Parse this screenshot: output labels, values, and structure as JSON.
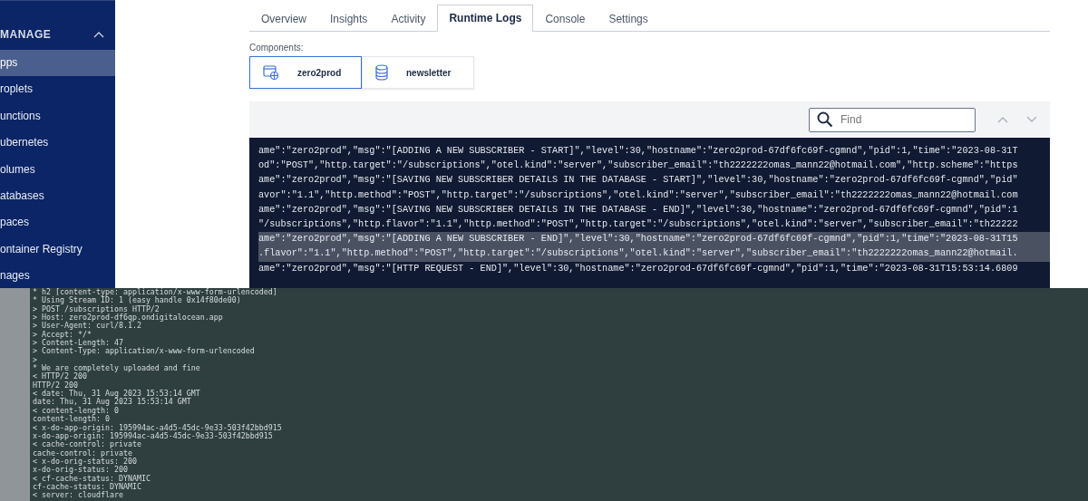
{
  "sidebar": {
    "section": {
      "label": "MANAGE",
      "expanded": true
    },
    "items": [
      {
        "label": "pps",
        "selected": true
      },
      {
        "label": "roplets",
        "selected": false
      },
      {
        "label": "unctions",
        "selected": false
      },
      {
        "label": "ubernetes",
        "selected": false
      },
      {
        "label": "olumes",
        "selected": false
      },
      {
        "label": "atabases",
        "selected": false
      },
      {
        "label": "paces",
        "selected": false
      },
      {
        "label": "ontainer Registry",
        "selected": false
      },
      {
        "label": "nages",
        "selected": false
      }
    ]
  },
  "tabs": [
    {
      "label": "Overview",
      "selected": false
    },
    {
      "label": "Insights",
      "selected": false
    },
    {
      "label": "Activity",
      "selected": false
    },
    {
      "label": "Runtime Logs",
      "selected": true
    },
    {
      "label": "Console",
      "selected": false
    },
    {
      "label": "Settings",
      "selected": false
    }
  ],
  "components": {
    "label": "Components:",
    "items": [
      {
        "name": "zero2prod",
        "kind": "app",
        "selected": true
      },
      {
        "name": "newsletter",
        "kind": "database",
        "selected": false
      }
    ]
  },
  "log_search": {
    "placeholder": "Find"
  },
  "log_lines": [
    {
      "text": "ame\":\"zero2prod\",\"msg\":\"[ADDING A NEW SUBSCRIBER - START]\",\"level\":30,\"hostname\":\"zero2prod-67df6fc69f-cgmnd\",\"pid\":1,\"time\":\"2023-08-31T",
      "selected": false
    },
    {
      "text": "od\":\"POST\",\"http.target\":\"/subscriptions\",\"otel.kind\":\"server\",\"subscriber_email\":\"th2222222omas_mann22@hotmail.com\",\"http.scheme\":\"https",
      "selected": false
    },
    {
      "text": "ame\":\"zero2prod\",\"msg\":\"[SAVING NEW SUBSCRIBER DETAILS IN THE DATABASE - START]\",\"level\":30,\"hostname\":\"zero2prod-67df6fc69f-cgmnd\",\"pid\"",
      "selected": false
    },
    {
      "text": "avor\":\"1.1\",\"http.method\":\"POST\",\"http.target\":\"/subscriptions\",\"otel.kind\":\"server\",\"subscriber_email\":\"th2222222omas_mann22@hotmail.com",
      "selected": false
    },
    {
      "text": "ame\":\"zero2prod\",\"msg\":\"[SAVING NEW SUBSCRIBER DETAILS IN THE DATABASE - END]\",\"level\":30,\"hostname\":\"zero2prod-67df6fc69f-cgmnd\",\"pid\":1",
      "selected": false
    },
    {
      "text": "\"/subscriptions\",\"http.flavor\":\"1.1\",\"http.method\":\"POST\",\"http.target\":\"/subscriptions\",\"otel.kind\":\"server\",\"subscriber_email\":\"th22222",
      "selected": false
    },
    {
      "text": "ame\":\"zero2prod\",\"msg\":\"[ADDING A NEW SUBSCRIBER - END]\",\"level\":30,\"hostname\":\"zero2prod-67df6fc69f-cgmnd\",\"pid\":1,\"time\":\"2023-08-31T15",
      "selected": true
    },
    {
      "text": ".flavor\":\"1.1\",\"http.method\":\"POST\",\"http.target\":\"/subscriptions\",\"otel.kind\":\"server\",\"subscriber_email\":\"th2222222omas_mann22@hotmail.",
      "selected": true
    },
    {
      "text": "ame\":\"zero2prod\",\"msg\":\"[HTTP REQUEST - END]\",\"level\":30,\"hostname\":\"zero2prod-67df6fc69f-cgmnd\",\"pid\":1,\"time\":\"2023-08-31T15:53:14.6809",
      "selected": false
    }
  ],
  "terminal_lines": [
    "* h2 [content-type: application/x-www-form-urlencoded]",
    "* Using Stream ID: 1 (easy handle 0x14f80de00)",
    "> POST /subscriptions HTTP/2",
    "> Host: zero2prod-df6qp.ondigitalocean.app",
    "> User-Agent: curl/8.1.2",
    "> Accept: */*",
    "> Content-Length: 47",
    "> Content-Type: application/x-www-form-urlencoded",
    ">",
    "* We are completely uploaded and fine",
    "< HTTP/2 200",
    "HTTP/2 200",
    "< date: Thu, 31 Aug 2023 15:53:14 GMT",
    "date: Thu, 31 Aug 2023 15:53:14 GMT",
    "< content-length: 0",
    "content-length: 0",
    "< x-do-app-origin: 195994ac-a4d5-45dc-9e33-503f42bbd915",
    "x-do-app-origin: 195994ac-a4d5-45dc-9e33-503f42bbd915",
    "< cache-control: private",
    "cache-control: private",
    "< x-do-orig-status: 200",
    "x-do-orig-status: 200",
    "< cf-cache-status: DYNAMIC",
    "cf-cache-status: DYNAMIC",
    "< server: cloudflare"
  ]
}
